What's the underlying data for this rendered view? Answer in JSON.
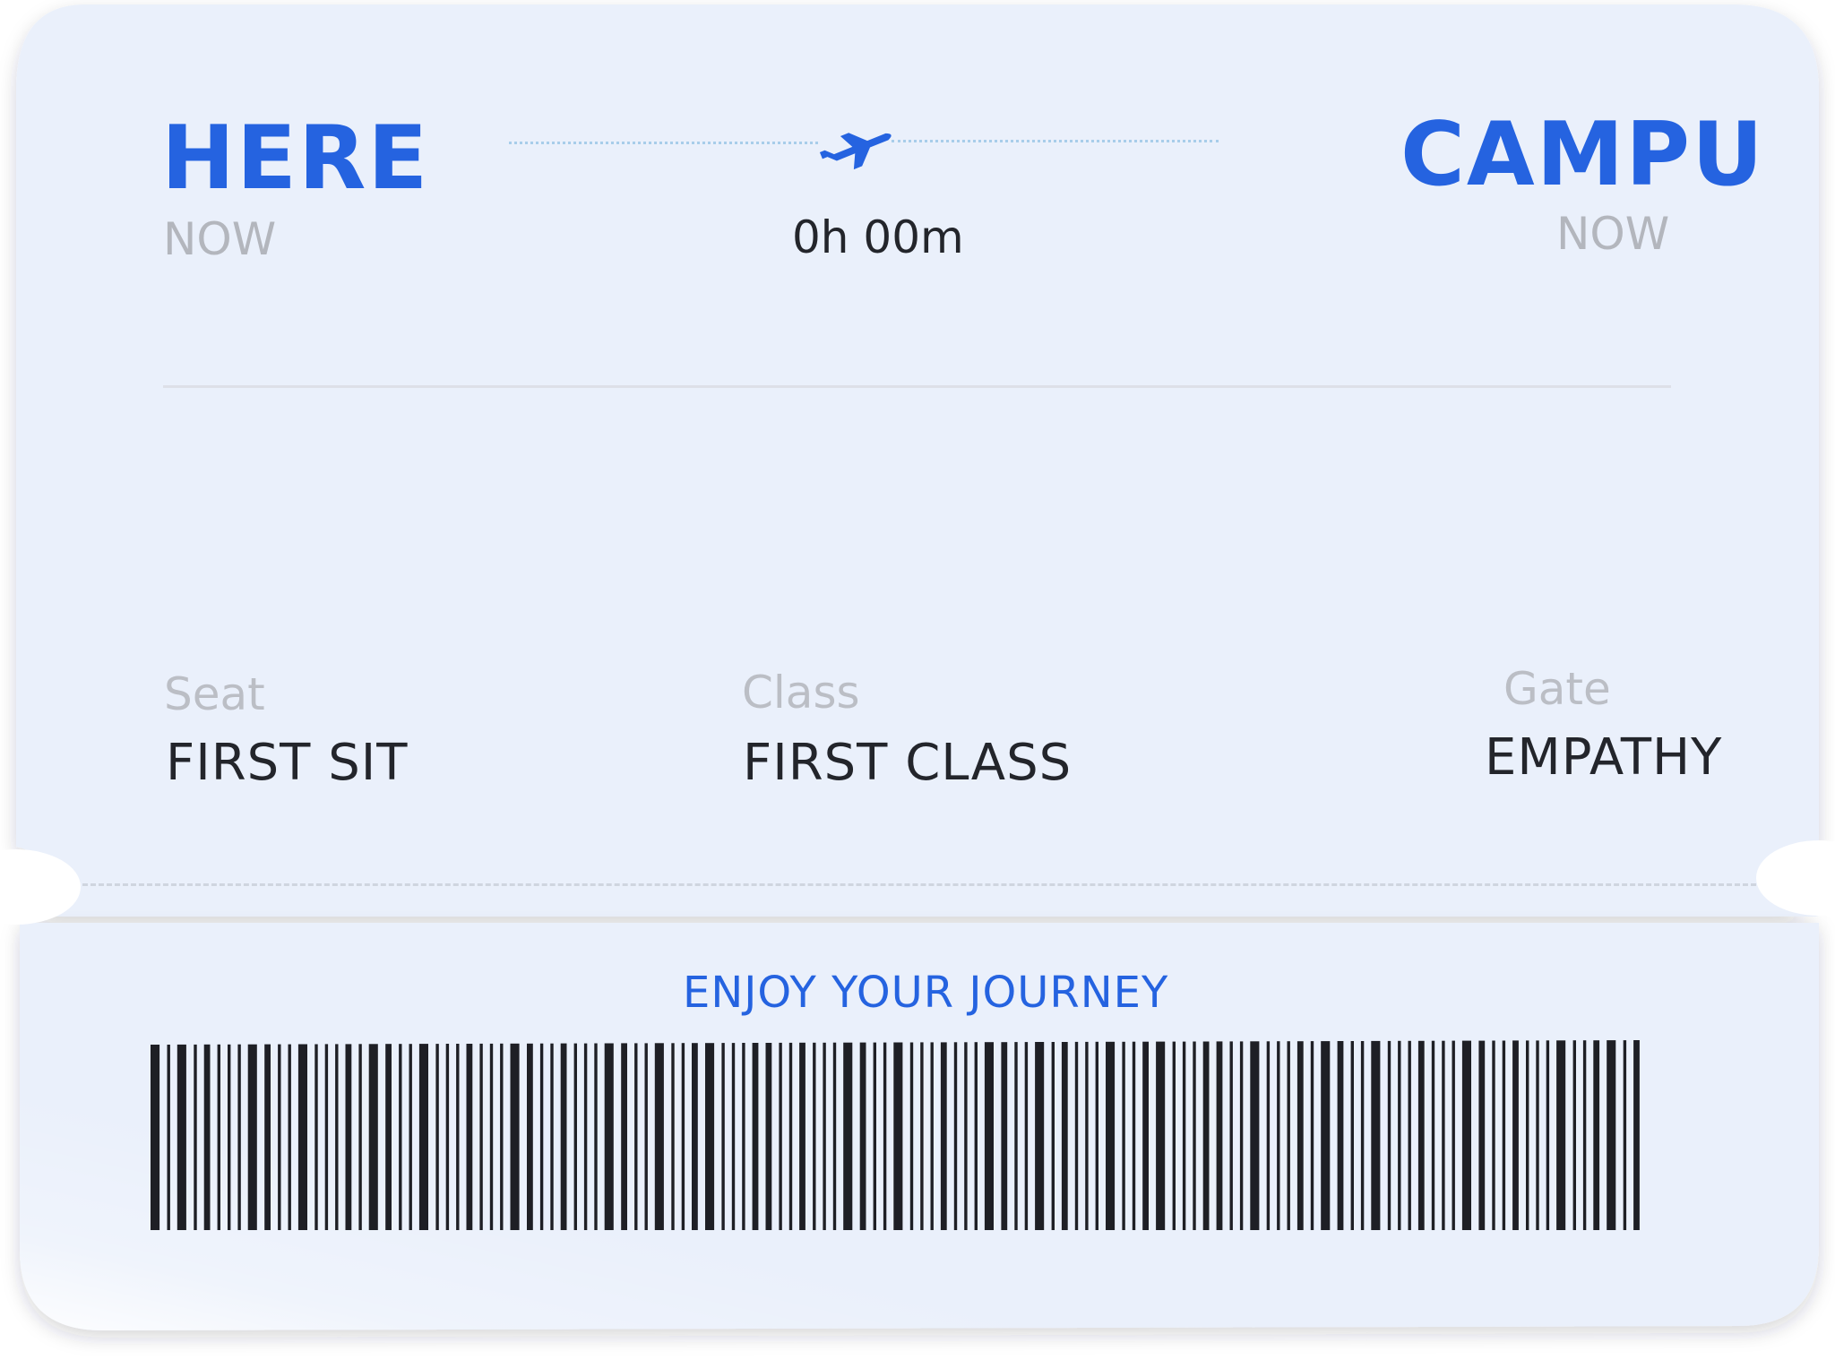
{
  "colors": {
    "accent": "#2563e0",
    "ticket_bg": "#eaf0fb",
    "text_dark": "#23252b",
    "text_muted": "#b3b6bd"
  },
  "origin": {
    "code": "HERE",
    "time": "NOW"
  },
  "destination": {
    "code": "CAMPU",
    "time": "NOW"
  },
  "flight": {
    "icon": "airplane-takeoff-icon",
    "duration": "0h 00m"
  },
  "details": {
    "seat": {
      "label": "Seat",
      "value": "FIRST SIT"
    },
    "class": {
      "label": "Class",
      "value": "FIRST CLASS"
    },
    "gate": {
      "label": "Gate",
      "value": "EMPATHY"
    }
  },
  "footer": {
    "message": "ENJOY YOUR JOURNEY"
  },
  "barcode": {
    "bars": [
      3,
      1,
      3,
      1,
      2,
      1,
      1,
      1,
      3,
      2,
      1,
      1,
      3,
      1,
      1,
      1,
      2,
      1,
      3,
      2,
      1,
      1,
      3,
      1,
      1,
      1,
      2,
      1,
      1,
      1,
      3,
      2,
      1,
      1,
      2,
      1,
      1,
      1,
      3,
      2,
      1,
      1,
      3,
      1,
      1,
      2,
      3,
      1,
      1,
      1,
      2,
      2,
      1,
      1,
      2,
      1,
      1,
      1,
      3,
      2,
      1,
      1,
      3,
      1,
      1,
      1,
      2,
      1,
      1,
      1,
      3,
      2,
      1,
      1,
      3,
      1,
      2,
      1,
      1,
      1,
      3,
      1,
      1,
      2,
      3,
      1,
      1,
      1,
      2,
      2,
      1,
      1,
      3,
      1,
      1,
      1,
      2,
      1,
      3,
      2,
      1,
      1,
      3,
      1,
      1,
      1,
      2,
      1,
      1,
      1,
      3,
      2,
      1,
      1,
      2,
      1,
      1,
      1,
      3,
      1,
      1,
      2,
      3,
      1,
      2
    ]
  }
}
